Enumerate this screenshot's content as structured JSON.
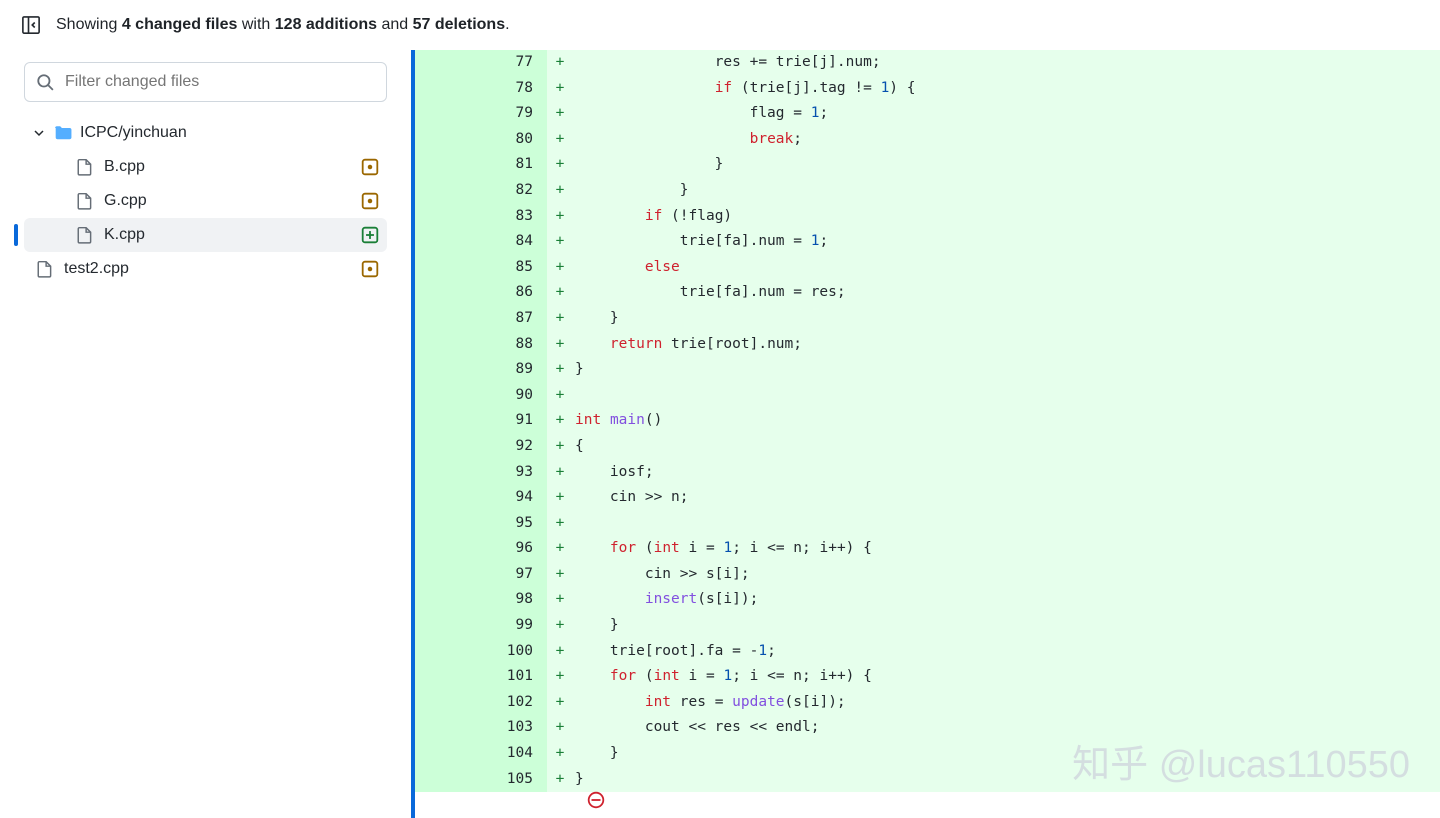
{
  "summary": {
    "prefix": "Showing ",
    "files_count": "4 changed files",
    "mid1": " with ",
    "additions": "128 additions",
    "mid2": " and ",
    "deletions": "57 deletions",
    "suffix": "."
  },
  "filter": {
    "placeholder": "Filter changed files"
  },
  "tree": {
    "folder": {
      "name": "ICPC/yinchuan"
    },
    "files": [
      {
        "name": "B.cpp",
        "status": "modified",
        "selected": false
      },
      {
        "name": "G.cpp",
        "status": "modified",
        "selected": false
      },
      {
        "name": "K.cpp",
        "status": "added",
        "selected": true
      }
    ],
    "root_files": [
      {
        "name": "test2.cpp",
        "status": "modified"
      }
    ]
  },
  "diff": {
    "lines": [
      {
        "n": 77,
        "t": [
          [
            "p",
            "                "
          ],
          [
            "p",
            "res += trie[j].num;"
          ]
        ]
      },
      {
        "n": 78,
        "t": [
          [
            "p",
            "                "
          ],
          [
            "kw",
            "if"
          ],
          [
            "p",
            " (trie[j].tag != "
          ],
          [
            "num",
            "1"
          ],
          [
            "p",
            ") {"
          ]
        ]
      },
      {
        "n": 79,
        "t": [
          [
            "p",
            "                    flag = "
          ],
          [
            "num",
            "1"
          ],
          [
            "p",
            ";"
          ]
        ]
      },
      {
        "n": 80,
        "t": [
          [
            "p",
            "                    "
          ],
          [
            "kw",
            "break"
          ],
          [
            "p",
            ";"
          ]
        ]
      },
      {
        "n": 81,
        "t": [
          [
            "p",
            "                }"
          ]
        ]
      },
      {
        "n": 82,
        "t": [
          [
            "p",
            "            }"
          ]
        ]
      },
      {
        "n": 83,
        "t": [
          [
            "p",
            "        "
          ],
          [
            "kw",
            "if"
          ],
          [
            "p",
            " (!flag)"
          ]
        ]
      },
      {
        "n": 84,
        "t": [
          [
            "p",
            "            trie[fa].num = "
          ],
          [
            "num",
            "1"
          ],
          [
            "p",
            ";"
          ]
        ]
      },
      {
        "n": 85,
        "t": [
          [
            "p",
            "        "
          ],
          [
            "kw",
            "else"
          ]
        ]
      },
      {
        "n": 86,
        "t": [
          [
            "p",
            "            trie[fa].num = res;"
          ]
        ]
      },
      {
        "n": 87,
        "t": [
          [
            "p",
            "    }"
          ]
        ]
      },
      {
        "n": 88,
        "t": [
          [
            "p",
            "    "
          ],
          [
            "kw",
            "return"
          ],
          [
            "p",
            " trie[root].num;"
          ]
        ]
      },
      {
        "n": 89,
        "t": [
          [
            "p",
            "}"
          ]
        ]
      },
      {
        "n": 90,
        "t": [
          [
            "p",
            ""
          ]
        ]
      },
      {
        "n": 91,
        "t": [
          [
            "kw",
            "int"
          ],
          [
            "p",
            " "
          ],
          [
            "fn",
            "main"
          ],
          [
            "p",
            "()"
          ]
        ]
      },
      {
        "n": 92,
        "t": [
          [
            "p",
            "{"
          ]
        ]
      },
      {
        "n": 93,
        "t": [
          [
            "p",
            "    iosf;"
          ]
        ]
      },
      {
        "n": 94,
        "t": [
          [
            "p",
            "    cin >> n;"
          ]
        ]
      },
      {
        "n": 95,
        "t": [
          [
            "p",
            ""
          ]
        ]
      },
      {
        "n": 96,
        "t": [
          [
            "p",
            "    "
          ],
          [
            "kw",
            "for"
          ],
          [
            "p",
            " ("
          ],
          [
            "kw",
            "int"
          ],
          [
            "p",
            " i = "
          ],
          [
            "num",
            "1"
          ],
          [
            "p",
            "; i <= n; i++) {"
          ]
        ]
      },
      {
        "n": 97,
        "t": [
          [
            "p",
            "        cin >> s[i];"
          ]
        ]
      },
      {
        "n": 98,
        "t": [
          [
            "p",
            "        "
          ],
          [
            "fn",
            "insert"
          ],
          [
            "p",
            "(s[i]);"
          ]
        ]
      },
      {
        "n": 99,
        "t": [
          [
            "p",
            "    }"
          ]
        ]
      },
      {
        "n": 100,
        "t": [
          [
            "p",
            "    trie[root].fa = -"
          ],
          [
            "num",
            "1"
          ],
          [
            "p",
            ";"
          ]
        ]
      },
      {
        "n": 101,
        "t": [
          [
            "p",
            "    "
          ],
          [
            "kw",
            "for"
          ],
          [
            "p",
            " ("
          ],
          [
            "kw",
            "int"
          ],
          [
            "p",
            " i = "
          ],
          [
            "num",
            "1"
          ],
          [
            "p",
            "; i <= n; i++) {"
          ]
        ]
      },
      {
        "n": 102,
        "t": [
          [
            "p",
            "        "
          ],
          [
            "kw",
            "int"
          ],
          [
            "p",
            " res = "
          ],
          [
            "fn",
            "update"
          ],
          [
            "p",
            "(s[i]);"
          ]
        ]
      },
      {
        "n": 103,
        "t": [
          [
            "p",
            "        cout << res << endl;"
          ]
        ]
      },
      {
        "n": 104,
        "t": [
          [
            "p",
            "    }"
          ]
        ]
      },
      {
        "n": 105,
        "t": [
          [
            "p",
            "}"
          ]
        ]
      }
    ]
  },
  "watermark": "知乎 @lucas110550"
}
